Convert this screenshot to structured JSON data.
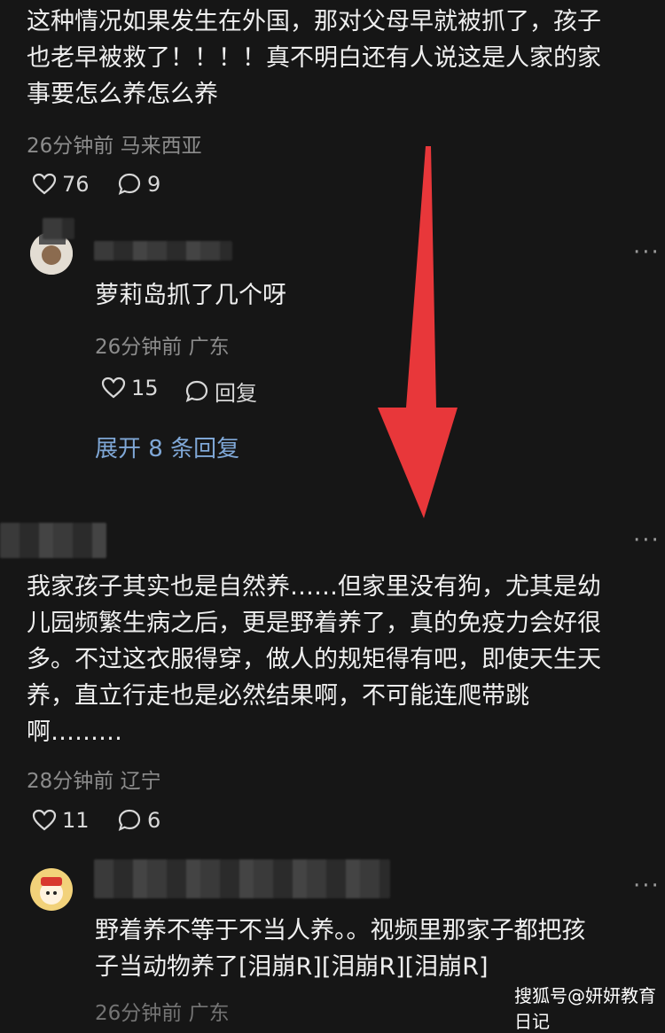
{
  "comment1": {
    "lines": [
      "这种情况如果发生在外国，那对父母早就被抓了，孩子",
      "也老早被救了！！！！真不明白还有人说这是人家的家",
      "事要怎么养怎么养"
    ],
    "time": "26分钟前",
    "location": "马来西亚",
    "likes": "76",
    "replies": "9"
  },
  "reply1": {
    "text": "萝莉岛抓了几个呀",
    "time": "26分钟前",
    "location": "广东",
    "likes": "15",
    "reply_label": "回复",
    "expand": "展开 8 条回复"
  },
  "comment2": {
    "lines": [
      "我家孩子其实也是自然养……但家里没有狗，尤其是幼",
      "儿园频繁生病之后，更是野着养了，真的免疫力会好很",
      "多。不过这衣服得穿，做人的规矩得有吧，即使天生天",
      "养，直立行走也是必然结果啊，不可能连爬带跳",
      "啊………"
    ],
    "time": "28分钟前",
    "location": "辽宁",
    "likes": "11",
    "replies": "6"
  },
  "reply2": {
    "lines": [
      "野着养不等于不当人养。。视频里那家子都把孩",
      "子当动物养了[泪崩R][泪崩R][泪崩R]"
    ],
    "time": "26分钟前",
    "location": "广东"
  },
  "more_label": "···",
  "watermark": "搜狐号@妍妍教育日记",
  "colors": {
    "arrow": "#e8373a",
    "link": "#7fa7d6",
    "background": "#161616"
  }
}
